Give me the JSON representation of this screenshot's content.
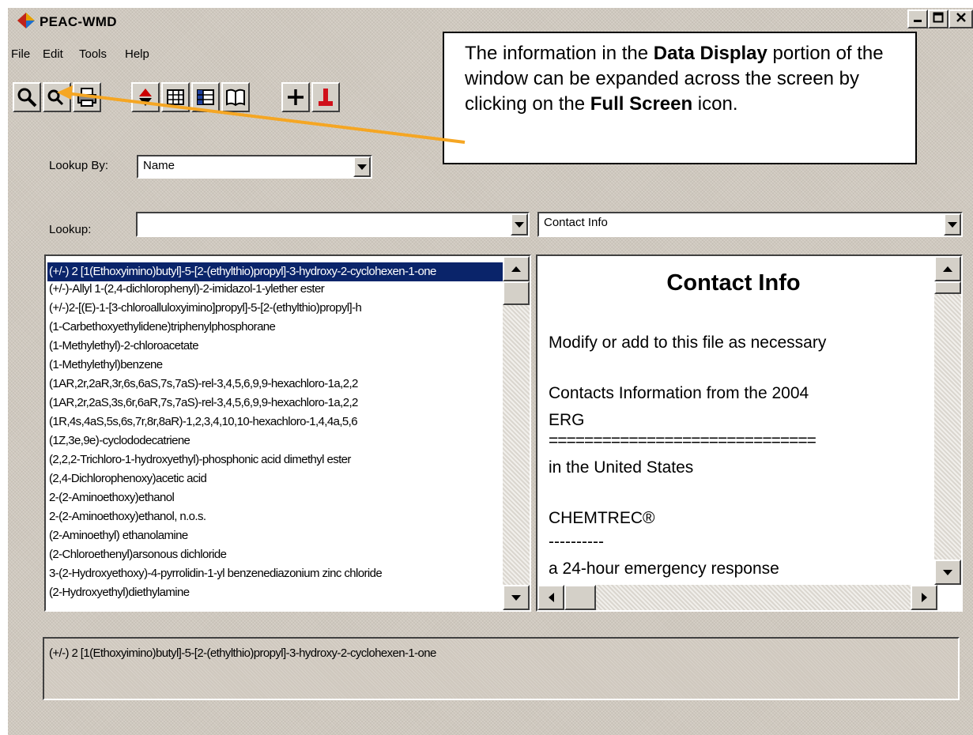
{
  "window": {
    "title": "PEAC-WMD",
    "controls": [
      "minimize",
      "maximize",
      "close"
    ]
  },
  "menu": [
    {
      "label": "File"
    },
    {
      "label": "Edit"
    },
    {
      "label": "Tools"
    },
    {
      "label": "Help"
    }
  ],
  "toolbar": {
    "buttons": [
      "search-icon",
      "zoom-in-search-icon",
      "print-icon",
      "sort-icon",
      "table-icon",
      "table-detail-icon",
      "book-icon",
      "add-icon",
      "flag-icon"
    ]
  },
  "lookup_by": {
    "label": "Lookup By:",
    "value": "Name"
  },
  "lookup": {
    "label": "Lookup:",
    "value": ""
  },
  "display_select": {
    "value": "Contact Info"
  },
  "chemical_list": {
    "selected_index": 0,
    "items": [
      "(+/-) 2 [1(Ethoxyimino)butyl]-5-[2-(ethylthio)propyl]-3-hydroxy-2-cyclohexen-1-one",
      "(+/-)-Allyl 1-(2,4-dichlorophenyl)-2-imidazol-1-ylether ester",
      "(+/-)2-[(E)-1-[3-chloroalluloxyimino]propyl]-5-[2-(ethylthio)propyl]-h",
      "(1-Carbethoxyethylidene)triphenylphosphorane",
      "(1-Methylethyl)-2-chloroacetate",
      "(1-Methylethyl)benzene",
      "(1AR,2r,2aR,3r,6s,6aS,7s,7aS)-rel-3,4,5,6,9,9-hexachloro-1a,2,2",
      "(1AR,2r,2aS,3s,6r,6aR,7s,7aS)-rel-3,4,5,6,9,9-hexachloro-1a,2,2",
      "(1R,4s,4aS,5s,6s,7r,8r,8aR)-1,2,3,4,10,10-hexachloro-1,4,4a,5,6",
      "(1Z,3e,9e)-cyclododecatriene",
      "(2,2,2-Trichloro-1-hydroxyethyl)-phosphonic acid dimethyl ester",
      "(2,4-Dichlorophenoxy)acetic acid",
      "2-(2-Aminoethoxy)ethanol",
      "2-(2-Aminoethoxy)ethanol, n.o.s.",
      "(2-Aminoethyl) ethanolamine",
      "(2-Chloroethenyl)arsonous dichloride",
      "3-(2-Hydroxyethoxy)-4-pyrrolidin-1-yl benzenediazonium zinc chloride",
      "(2-Hydroxyethyl)diethylamine"
    ]
  },
  "data_display": {
    "heading": "Contact Info",
    "lines": [
      "Modify or add to this file as necessary",
      "Contacts Information from the 2004",
      "ERG",
      "==============================",
      "in the United States",
      "CHEMTREC®",
      "----------",
      "a 24-hour emergency response"
    ]
  },
  "status": {
    "text": "(+/-) 2 [1(Ethoxyimino)butyl]-5-[2-(ethylthio)propyl]-3-hydroxy-2-cyclohexen-1-one"
  },
  "callout": {
    "t1": "The information in the ",
    "b1": "Data Display",
    "t2": " portion of the window can be expanded across the screen by clicking on the ",
    "b2": "Full Screen",
    "t3": " icon."
  },
  "colors": {
    "selection": "#0a246a",
    "arrow": "#f5a623",
    "window_bg": "#cfc8be"
  }
}
